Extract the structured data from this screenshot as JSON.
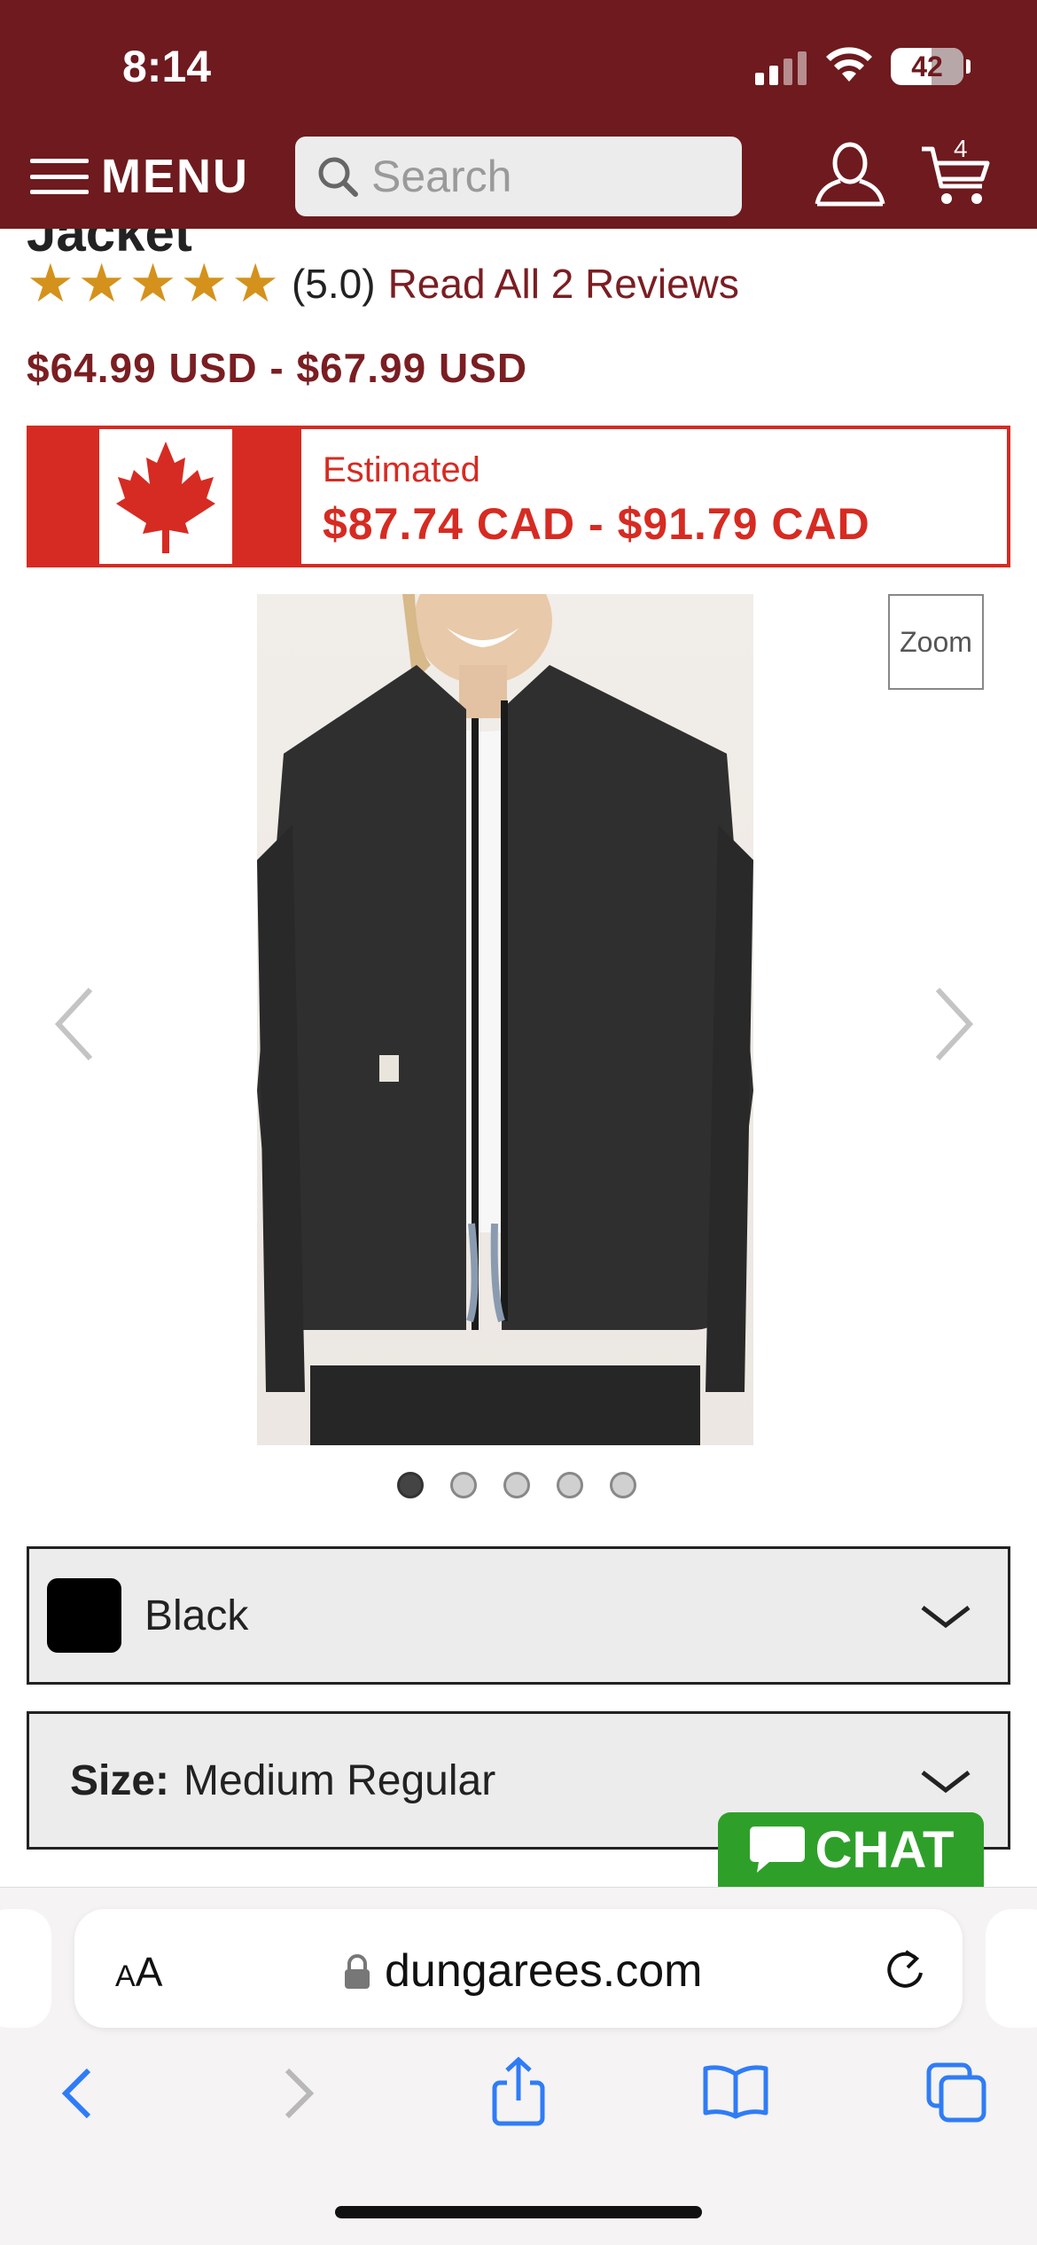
{
  "status_bar": {
    "time": "8:14",
    "battery": "42"
  },
  "header": {
    "menu_label": "MENU",
    "search_placeholder": "Search",
    "cart_count": "4"
  },
  "product": {
    "title_fragment": "Jacket",
    "rating_value": "(5.0)",
    "reviews_link": "Read All 2 Reviews",
    "stars": 5,
    "price_usd": "$64.99 USD - $67.99 USD",
    "estimate_label": "Estimated",
    "price_cad": "$87.74 CAD - $91.79 CAD",
    "zoom_label": "Zoom",
    "image_count": 5,
    "active_image_index": 0
  },
  "options": {
    "color_value": "Black",
    "color_swatch": "#000000",
    "size_label": "Size:",
    "size_value": "Medium Regular"
  },
  "chat": {
    "label": "CHAT",
    "color": "#2ea02a"
  },
  "browser": {
    "aa_label": "AA",
    "url": "dungarees.com"
  },
  "colors": {
    "brand": "#6e1a1e",
    "canada_red": "#d62b22",
    "star": "#d4921c"
  }
}
